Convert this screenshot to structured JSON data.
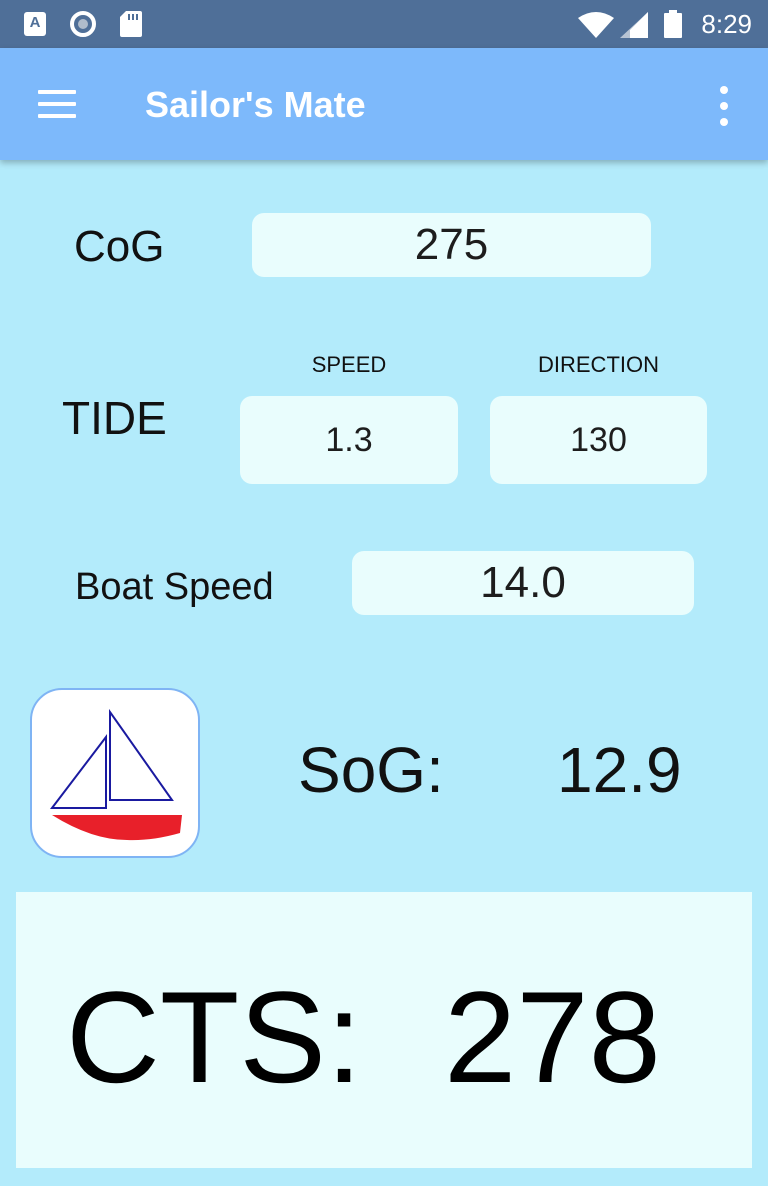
{
  "status_bar": {
    "time": "8:29",
    "left_icons": [
      "a-icon",
      "circle-icon",
      "sd-card-icon"
    ],
    "right_icons": [
      "wifi-icon",
      "signal-icon",
      "battery-icon"
    ],
    "a_glyph": "A"
  },
  "app_bar": {
    "title": "Sailor's Mate",
    "menu_icon": "hamburger-menu-icon",
    "overflow_icon": "more-vertical-icon",
    "color": "#7db9fb"
  },
  "cog": {
    "label": "CoG",
    "value": "275"
  },
  "tide": {
    "label": "TIDE",
    "speed_header": "SPEED",
    "direction_header": "DIRECTION",
    "speed_value": "1.3",
    "direction_value": "130"
  },
  "boat_speed": {
    "label": "Boat Speed",
    "value": "14.0"
  },
  "sog": {
    "label": "SoG:",
    "value": "12.9"
  },
  "cts": {
    "label": "CTS:",
    "value": "278"
  },
  "colors": {
    "background": "#b3ebfb",
    "field": "#e9fdfd",
    "status_bar": "#4f6f98",
    "hull": "#e8202a",
    "sail_outline": "#1a1aa0"
  }
}
